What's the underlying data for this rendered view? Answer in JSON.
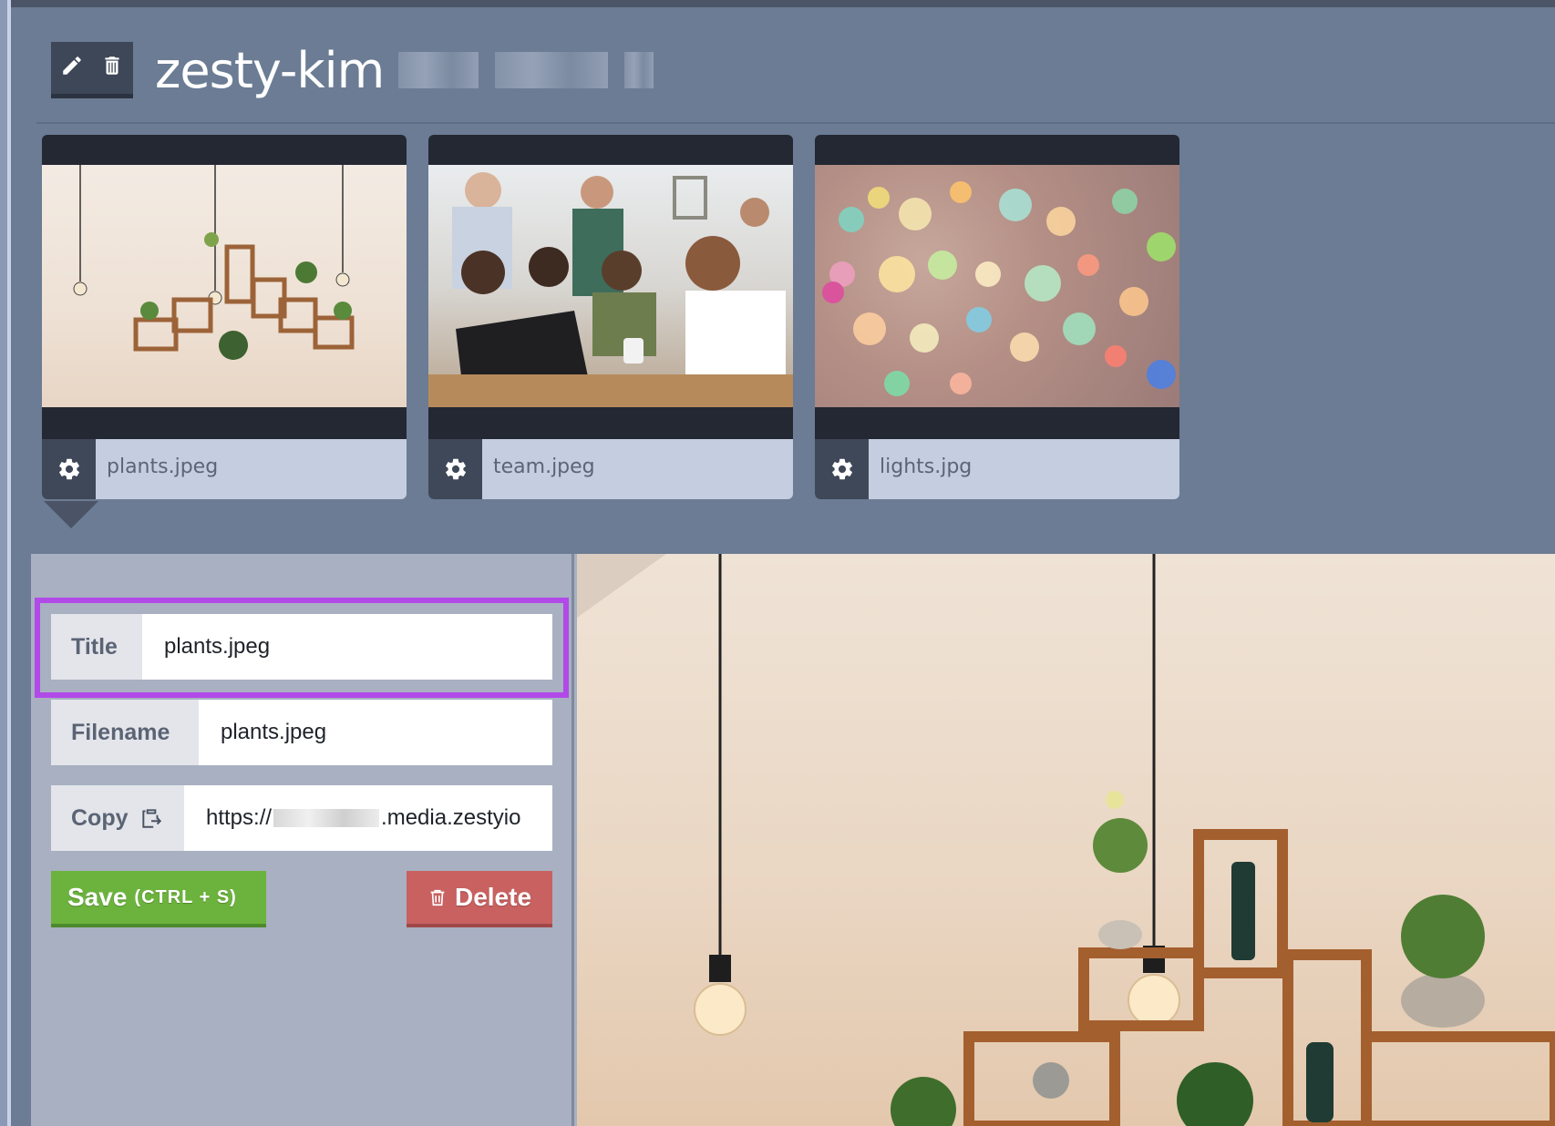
{
  "header": {
    "title": "zesty-kim",
    "edit_icon": "pencil-icon",
    "delete_icon": "trash-icon"
  },
  "files": [
    {
      "name": "plants.jpeg"
    },
    {
      "name": "team.jpeg"
    },
    {
      "name": "lights.jpg"
    }
  ],
  "detail": {
    "title_label": "Title",
    "title_value": "plants.jpeg",
    "filename_label": "Filename",
    "filename_value": "plants.jpeg",
    "copy_label": "Copy",
    "url_prefix": "https://",
    "url_suffix": ".media.zestyio",
    "save_label": "Save",
    "save_shortcut": "(CTRL + S)",
    "delete_label": "Delete"
  },
  "colors": {
    "background": "#6b7c94",
    "save": "#6cb33e",
    "delete": "#c96161",
    "highlight": "#b14ae8"
  }
}
